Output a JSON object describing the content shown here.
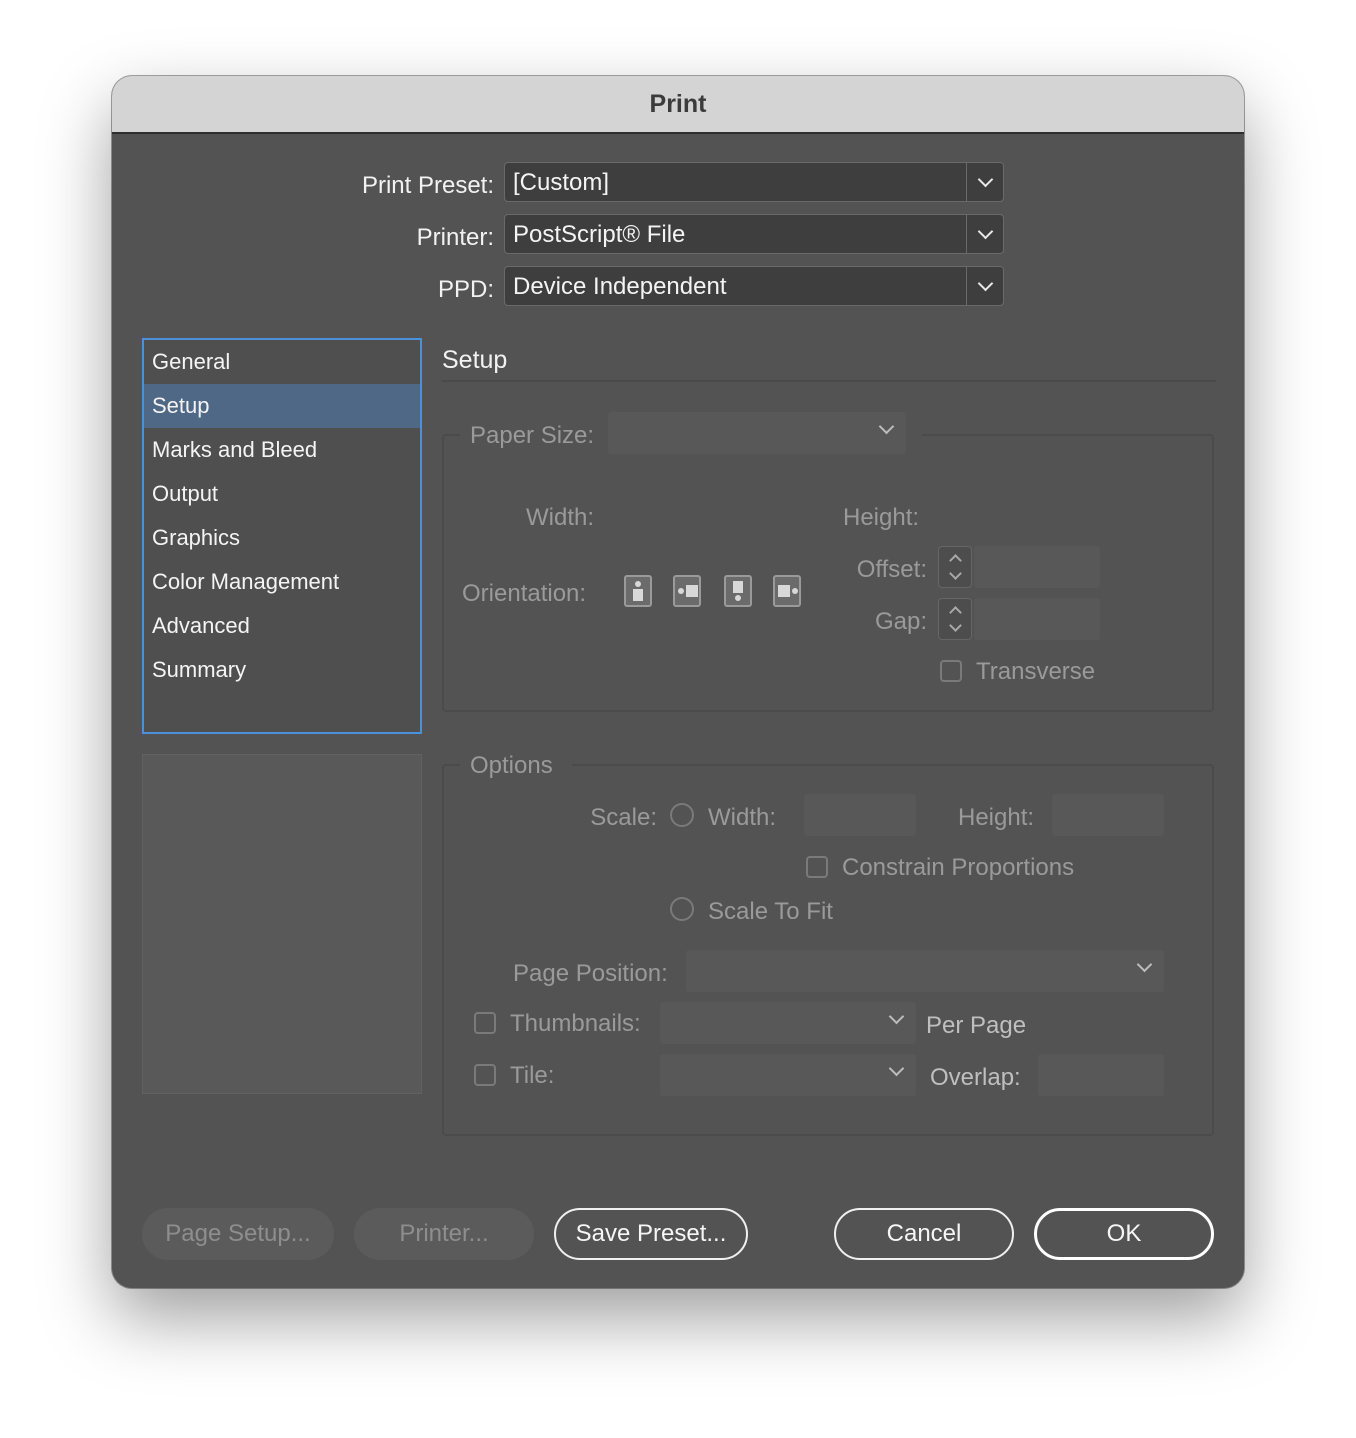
{
  "window": {
    "title": "Print"
  },
  "top": {
    "preset": {
      "label": "Print Preset:",
      "value": "[Custom]"
    },
    "printer": {
      "label": "Printer:",
      "value": "PostScript® File"
    },
    "ppd": {
      "label": "PPD:",
      "value": "Device Independent"
    }
  },
  "sidebar": {
    "items": [
      {
        "label": "General"
      },
      {
        "label": "Setup",
        "selected": true
      },
      {
        "label": "Marks and Bleed"
      },
      {
        "label": "Output"
      },
      {
        "label": "Graphics"
      },
      {
        "label": "Color Management"
      },
      {
        "label": "Advanced"
      },
      {
        "label": "Summary"
      }
    ]
  },
  "section": {
    "title": "Setup"
  },
  "paper": {
    "size_label": "Paper Size:",
    "width_label": "Width:",
    "height_label": "Height:",
    "offset_label": "Offset:",
    "gap_label": "Gap:",
    "orientation_label": "Orientation:",
    "transverse_label": "Transverse",
    "orientation_icons": [
      "portrait-icon",
      "landscape-icon",
      "reverse-portrait-icon",
      "reverse-landscape-icon"
    ]
  },
  "options": {
    "title": "Options",
    "scale_label": "Scale:",
    "width_label": "Width:",
    "height_label": "Height:",
    "constrain_label": "Constrain Proportions",
    "scale_to_fit_label": "Scale To Fit",
    "page_position_label": "Page Position:",
    "thumbnails_label": "Thumbnails:",
    "per_page_label": "Per Page",
    "tile_label": "Tile:",
    "overlap_label": "Overlap:"
  },
  "buttons": {
    "page_setup": "Page Setup...",
    "printer": "Printer...",
    "save_preset": "Save Preset...",
    "cancel": "Cancel",
    "ok": "OK"
  },
  "colors": {
    "window_bg": "#535353",
    "selection": "#4f6886",
    "focus_ring": "#4d8fd8"
  }
}
